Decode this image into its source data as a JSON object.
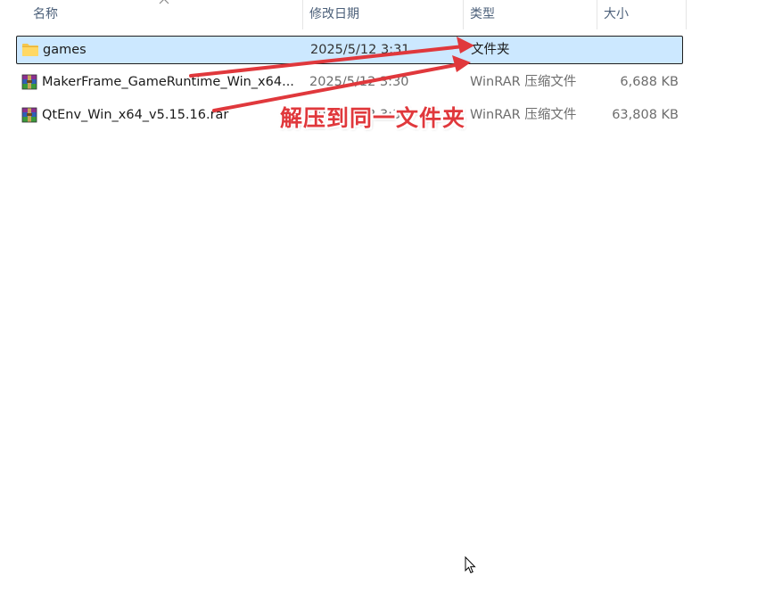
{
  "header": {
    "columns": [
      {
        "label": "名称"
      },
      {
        "label": "修改日期"
      },
      {
        "label": "类型"
      },
      {
        "label": "大小"
      }
    ]
  },
  "files": [
    {
      "name": "games",
      "date": "2025/5/12 3:31",
      "type": "文件夹",
      "size": "",
      "icon": "folder-icon",
      "selected": true
    },
    {
      "name": "MakerFrame_GameRuntime_Win_x64...",
      "date": "2025/5/12 3:30",
      "type": "WinRAR 压缩文件",
      "size": "6,688 KB",
      "icon": "winrar-archive-icon",
      "selected": false
    },
    {
      "name": "QtEnv_Win_x64_v5.15.16.rar",
      "date": "2025/5/12 3:30",
      "type": "WinRAR 压缩文件",
      "size": "63,808 KB",
      "icon": "winrar-archive-icon",
      "selected": false
    }
  ],
  "annotation": {
    "text": "解压到同一文件夹",
    "color": "#e0383c"
  },
  "colors": {
    "selection_bg": "#cce8ff",
    "header_text": "#4c607a",
    "secondary_text": "#6d6d6d"
  }
}
